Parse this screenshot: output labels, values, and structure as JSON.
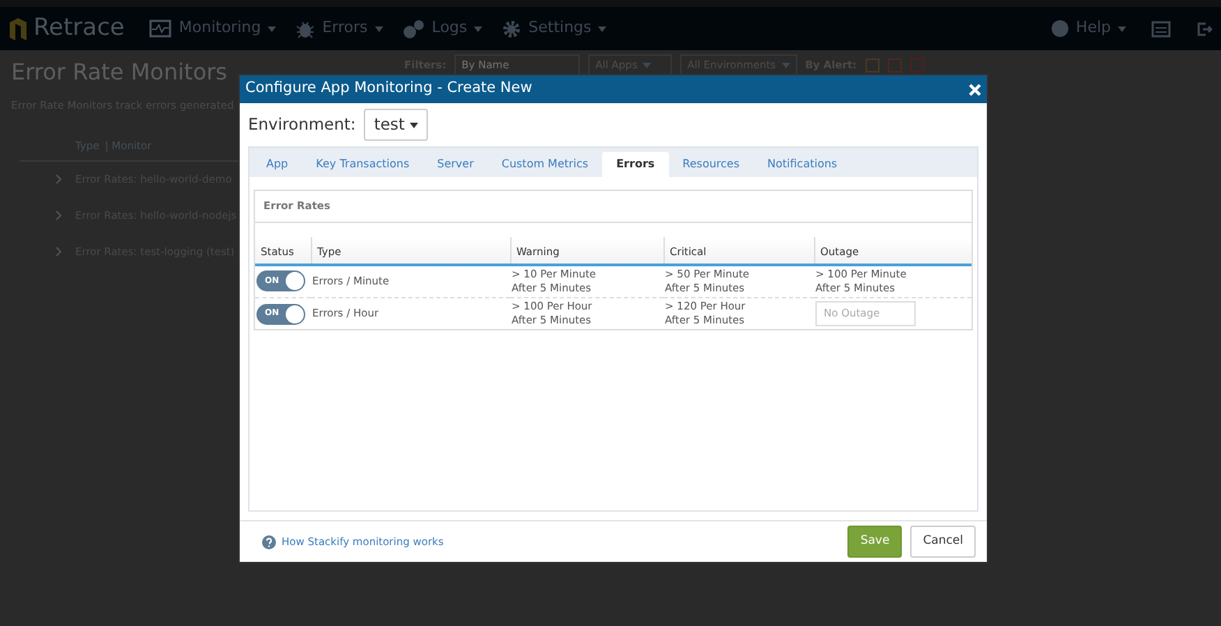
{
  "navbar": {
    "brand": "Retrace",
    "menus": [
      {
        "label": "Monitoring",
        "kind": "monitor"
      },
      {
        "label": "Errors",
        "kind": "bug"
      },
      {
        "label": "Logs",
        "kind": "logs"
      },
      {
        "label": "Settings",
        "kind": "gear"
      }
    ],
    "help": "Help"
  },
  "page": {
    "title": "Error Rate Monitors",
    "description": "Error Rate Monitors track errors generated",
    "filters": {
      "label": "Filters:",
      "search_placeholder": "By Name",
      "apps": "All Apps",
      "environments": "All Environments",
      "alert_label": "By Alert:",
      "alerts": [
        {
          "checked": false,
          "color": "#4a3a20"
        },
        {
          "checked": false,
          "color": "#4d2a1c"
        },
        {
          "checked": false,
          "color": "#4f201a"
        }
      ]
    },
    "columns": [
      "Type",
      "| Monitor"
    ],
    "rows": [
      "Error Rates: hello-world-demo",
      "Error Rates: hello-world-nodejs",
      "Error Rates: test-logging (test)"
    ]
  },
  "modal": {
    "title": "Configure App Monitoring - Create New",
    "environment_label": "Environment:",
    "environment": "test",
    "tabs": [
      {
        "label": "App",
        "selected": false
      },
      {
        "label": "Key Transactions",
        "selected": false
      },
      {
        "label": "Server",
        "selected": false
      },
      {
        "label": "Custom Metrics",
        "selected": false
      },
      {
        "label": "Errors",
        "selected": true
      },
      {
        "label": "Resources",
        "selected": false
      },
      {
        "label": "Notifications",
        "selected": false
      }
    ],
    "section_title": "Error Rates",
    "columns": [
      "Status",
      "Type",
      "Warning",
      "Critical",
      "Outage"
    ],
    "rows": [
      {
        "on": true,
        "toggle_label": "ON",
        "type": "Errors / Minute",
        "warning": [
          "> 10 Per Minute",
          "After 5 Minutes"
        ],
        "critical": [
          "> 50 Per Minute",
          "After 5 Minutes"
        ],
        "outage": {
          "lines": [
            "> 100 Per Minute",
            "After 5 Minutes"
          ]
        }
      },
      {
        "on": true,
        "toggle_label": "ON",
        "type": "Errors / Hour",
        "warning": [
          "> 100 Per Hour",
          "After 5 Minutes"
        ],
        "critical": [
          "> 120 Per Hour",
          "After 5 Minutes"
        ],
        "outage": {
          "placeholder": "No Outage"
        }
      }
    ],
    "help_link": "How Stackify monitoring works",
    "buttons": {
      "save": "Save",
      "cancel": "Cancel"
    }
  }
}
